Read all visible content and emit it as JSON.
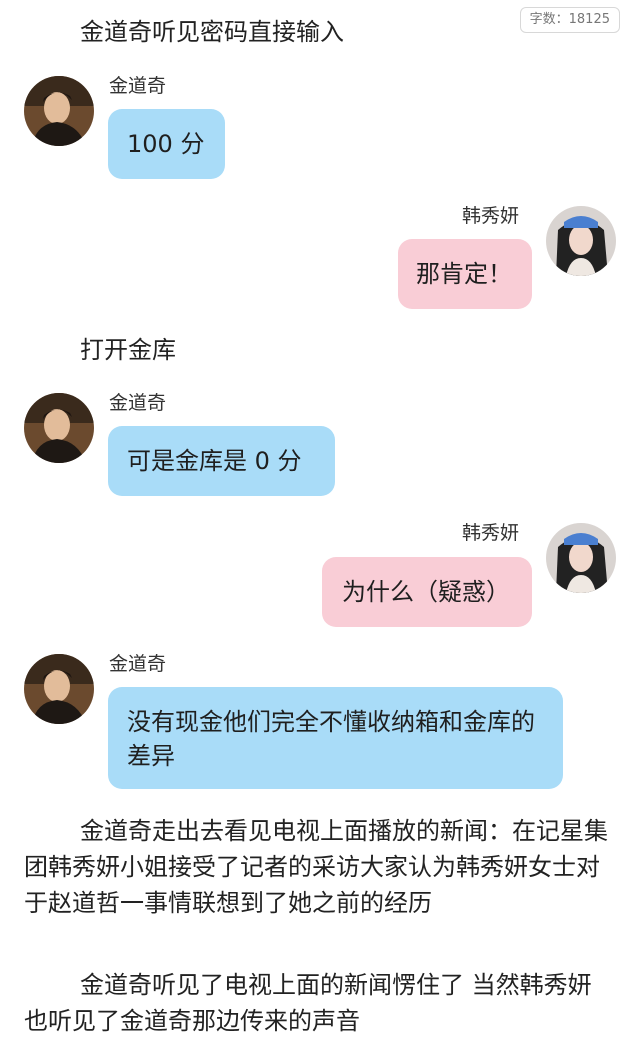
{
  "word_count": "字数：18125",
  "messages": {
    "narration_1": "金道奇听见密码直接输入",
    "m1_speaker": "金道奇",
    "m1_text": "100 分",
    "m2_speaker": "韩秀妍",
    "m2_text": "那肯定！",
    "narration_2": "打开金库",
    "m3_speaker": "金道奇",
    "m3_text": "可是金库是 0 分",
    "m4_speaker": "韩秀妍",
    "m4_text": "为什么（疑惑）",
    "m5_speaker": "金道奇",
    "m5_text": "没有现金他们完全不懂收纳箱和金库的差异",
    "narration_3": "金道奇走出去看见电视上面播放的新闻：在记星集团韩秀妍小姐接受了记者的采访大家认为韩秀妍女士对于赵道哲一事情联想到了她之前的经历",
    "narration_4": "金道奇听见了电视上面的新闻愣住了 当然韩秀妍也听见了金道奇那边传来的声音"
  },
  "colors": {
    "male_bubble": "#a9dcf8",
    "female_bubble": "#f9cdd6"
  },
  "icons": {
    "male_avatar": "portrait of 金道奇",
    "female_avatar": "portrait of 韩秀妍"
  }
}
